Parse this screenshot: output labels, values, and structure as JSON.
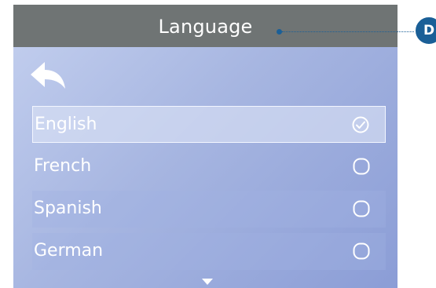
{
  "header": {
    "title": "Language"
  },
  "callout": {
    "badge_label": "D"
  },
  "languages": [
    {
      "label": "English",
      "selected": true
    },
    {
      "label": "French",
      "selected": false
    },
    {
      "label": "Spanish",
      "selected": false
    },
    {
      "label": "German",
      "selected": false
    }
  ],
  "icons": {
    "back": "back-arrow-icon",
    "checked": "circle-check-icon",
    "unchecked": "circle-empty-icon",
    "scroll": "triangle-down-icon"
  },
  "colors": {
    "header_bg": "#6f7474",
    "accent": "#1a5f97",
    "text": "#ffffff"
  }
}
